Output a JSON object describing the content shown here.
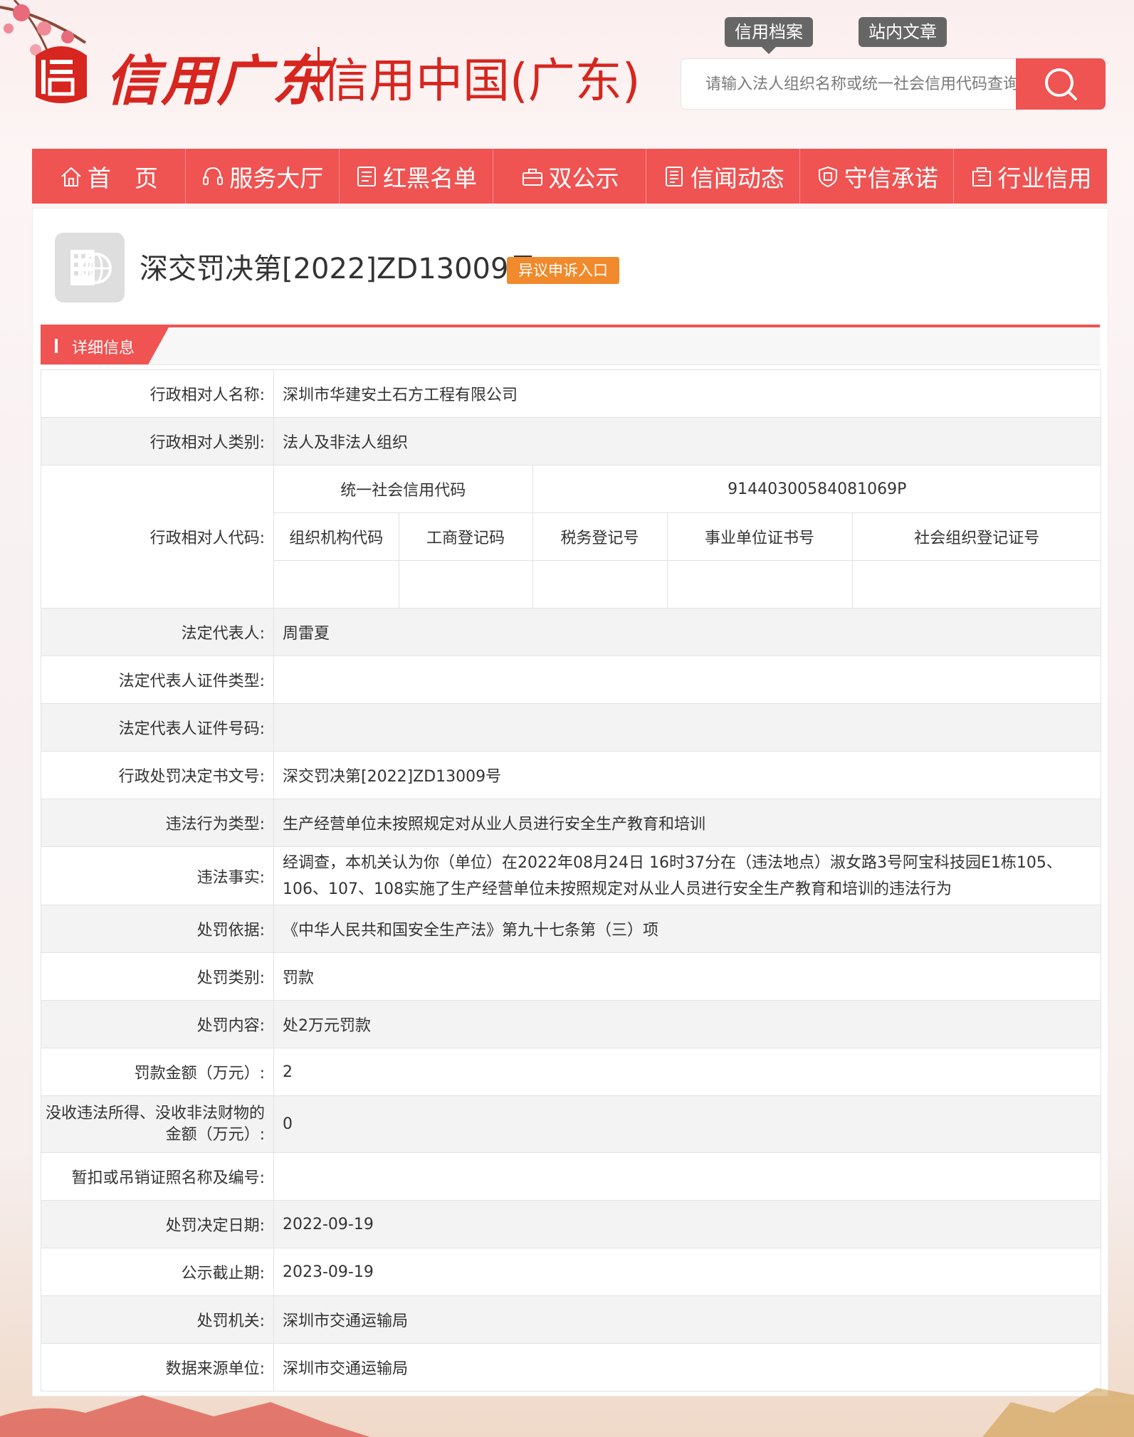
{
  "header": {
    "brand_script": "信用广东",
    "brand_text": "信用中国(广东)",
    "top_tabs": [
      "信用档案",
      "站内文章"
    ],
    "search_placeholder": "请输入法人组织名称或统一社会信用代码查询"
  },
  "nav": {
    "items": [
      "首　页",
      "服务大厅",
      "红黑名单",
      "双公示",
      "信闻动态",
      "守信承诺",
      "行业信用"
    ]
  },
  "detail": {
    "title": "深交罚决第[2022]ZD13009号",
    "appeal_label": "异议申诉入口",
    "section_label": "详细信息"
  },
  "fields": {
    "party_name_label": "行政相对人名称:",
    "party_name": "深圳市华建安土石方工程有限公司",
    "party_type_label": "行政相对人类别:",
    "party_type": "法人及非法人组织",
    "party_code_label": "行政相对人代码:",
    "uscc_label": "统一社会信用代码",
    "uscc_value": "91440300584081069P",
    "code_headers": [
      "组织机构代码",
      "工商登记码",
      "税务登记号",
      "事业单位证书号",
      "社会组织登记证号"
    ],
    "legal_rep_label": "法定代表人:",
    "legal_rep": "周雷夏",
    "legal_rep_id_type_label": "法定代表人证件类型:",
    "legal_rep_id_no_label": "法定代表人证件号码:",
    "decision_no_label": "行政处罚决定书文号:",
    "decision_no": "深交罚决第[2022]ZD13009号",
    "violation_type_label": "违法行为类型:",
    "violation_type": "生产经营单位未按照规定对从业人员进行安全生产教育和培训",
    "violation_facts_label": "违法事实:",
    "violation_facts": "经调查，本机关认为你（单位）在2022年08月24日 16时37分在（违法地点）淑女路3号阿宝科技园E1栋105、106、107、108实施了生产经营单位未按照规定对从业人员进行安全生产教育和培训的违法行为",
    "basis_label": "处罚依据:",
    "basis": "《中华人民共和国安全生产法》第九十七条第（三）项",
    "penalty_category_label": "处罚类别:",
    "penalty_category": "罚款",
    "penalty_content_label": "处罚内容:",
    "penalty_content": "处2万元罚款",
    "fine_amount_label": "罚款金额（万元）:",
    "fine_amount": "2",
    "confiscation_label": "没收违法所得、没收非法财物的金额（万元）:",
    "confiscation_amount": "0",
    "license_label": "暂扣或吊销证照名称及编号:",
    "decision_date_label": "处罚决定日期:",
    "decision_date": "2022-09-19",
    "publicity_end_label": "公示截止期:",
    "publicity_end": "2023-09-19",
    "authority_label": "处罚机关:",
    "authority": "深圳市交通运输局",
    "source_label": "数据来源单位:",
    "source": "深圳市交通运输局"
  },
  "colors": {
    "accent": "#ef5352",
    "brand_red": "#d6261f",
    "appeal_orange": "#f08a2c",
    "tab_grey": "#666666"
  }
}
